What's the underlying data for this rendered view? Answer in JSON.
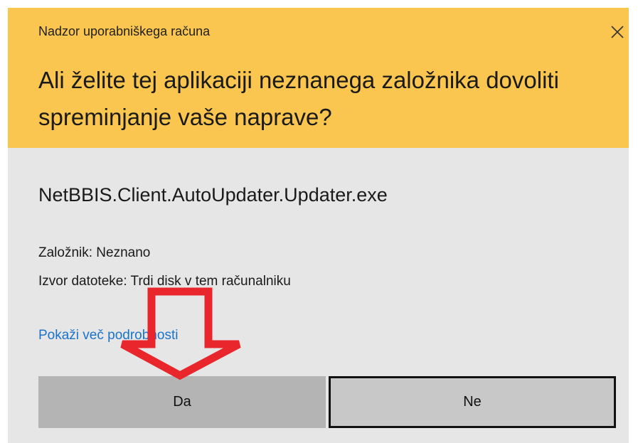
{
  "dialog": {
    "caption": "Nadzor uporabniškega računa",
    "question": "Ali želite tej aplikaciji neznanega založnika dovoliti spreminjanje vaše naprave?",
    "filename": "NetBBIS.Client.AutoUpdater.Updater.exe",
    "publisher": "Založnik: Neznano",
    "source": "Izvor datoteke: Trdi disk v tem računalniku",
    "details_link": "Pokaži več podrobnosti",
    "yes_label": "Da",
    "no_label": "Ne",
    "close_icon": "close-icon"
  },
  "colors": {
    "header_bg": "#fbc64f",
    "body_bg": "#e6e6e6",
    "link": "#1a73c9",
    "annotation_arrow": "#e8262b"
  }
}
